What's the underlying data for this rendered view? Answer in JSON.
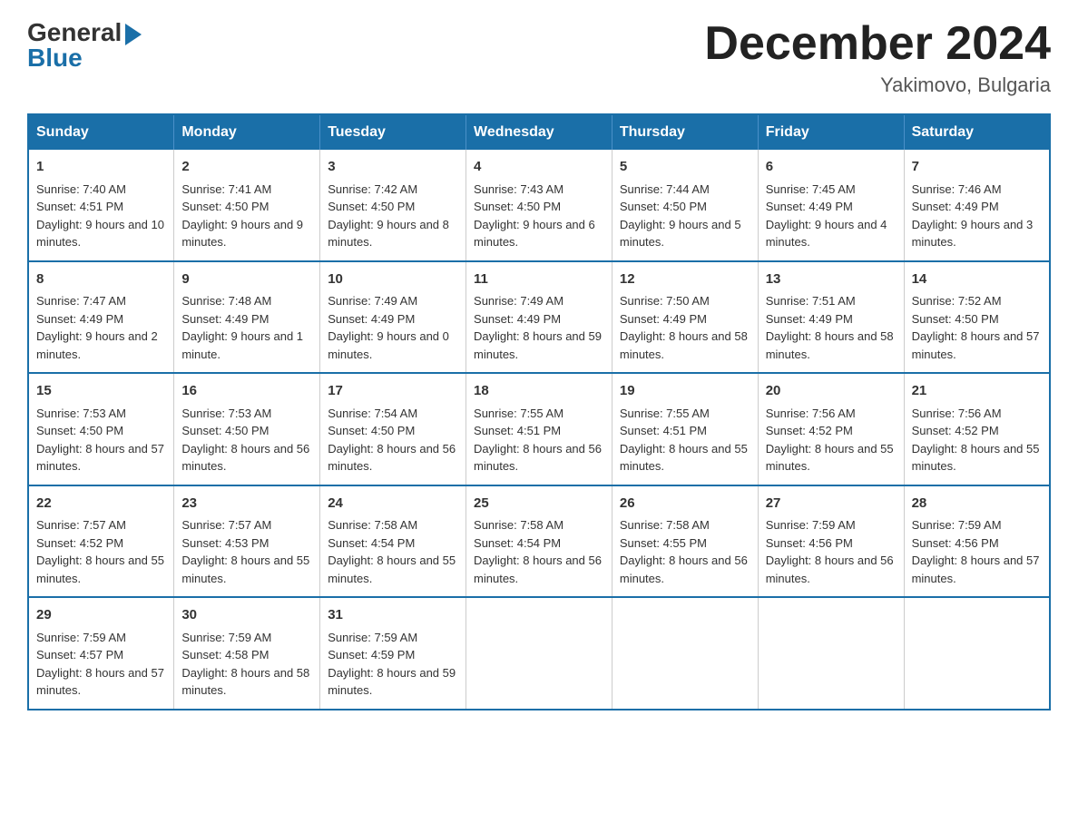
{
  "logo": {
    "general": "General",
    "blue": "Blue"
  },
  "title": "December 2024",
  "location": "Yakimovo, Bulgaria",
  "weekdays": [
    "Sunday",
    "Monday",
    "Tuesday",
    "Wednesday",
    "Thursday",
    "Friday",
    "Saturday"
  ],
  "weeks": [
    [
      {
        "day": "1",
        "sunrise": "7:40 AM",
        "sunset": "4:51 PM",
        "daylight": "9 hours and 10 minutes."
      },
      {
        "day": "2",
        "sunrise": "7:41 AM",
        "sunset": "4:50 PM",
        "daylight": "9 hours and 9 minutes."
      },
      {
        "day": "3",
        "sunrise": "7:42 AM",
        "sunset": "4:50 PM",
        "daylight": "9 hours and 8 minutes."
      },
      {
        "day": "4",
        "sunrise": "7:43 AM",
        "sunset": "4:50 PM",
        "daylight": "9 hours and 6 minutes."
      },
      {
        "day": "5",
        "sunrise": "7:44 AM",
        "sunset": "4:50 PM",
        "daylight": "9 hours and 5 minutes."
      },
      {
        "day": "6",
        "sunrise": "7:45 AM",
        "sunset": "4:49 PM",
        "daylight": "9 hours and 4 minutes."
      },
      {
        "day": "7",
        "sunrise": "7:46 AM",
        "sunset": "4:49 PM",
        "daylight": "9 hours and 3 minutes."
      }
    ],
    [
      {
        "day": "8",
        "sunrise": "7:47 AM",
        "sunset": "4:49 PM",
        "daylight": "9 hours and 2 minutes."
      },
      {
        "day": "9",
        "sunrise": "7:48 AM",
        "sunset": "4:49 PM",
        "daylight": "9 hours and 1 minute."
      },
      {
        "day": "10",
        "sunrise": "7:49 AM",
        "sunset": "4:49 PM",
        "daylight": "9 hours and 0 minutes."
      },
      {
        "day": "11",
        "sunrise": "7:49 AM",
        "sunset": "4:49 PM",
        "daylight": "8 hours and 59 minutes."
      },
      {
        "day": "12",
        "sunrise": "7:50 AM",
        "sunset": "4:49 PM",
        "daylight": "8 hours and 58 minutes."
      },
      {
        "day": "13",
        "sunrise": "7:51 AM",
        "sunset": "4:49 PM",
        "daylight": "8 hours and 58 minutes."
      },
      {
        "day": "14",
        "sunrise": "7:52 AM",
        "sunset": "4:50 PM",
        "daylight": "8 hours and 57 minutes."
      }
    ],
    [
      {
        "day": "15",
        "sunrise": "7:53 AM",
        "sunset": "4:50 PM",
        "daylight": "8 hours and 57 minutes."
      },
      {
        "day": "16",
        "sunrise": "7:53 AM",
        "sunset": "4:50 PM",
        "daylight": "8 hours and 56 minutes."
      },
      {
        "day": "17",
        "sunrise": "7:54 AM",
        "sunset": "4:50 PM",
        "daylight": "8 hours and 56 minutes."
      },
      {
        "day": "18",
        "sunrise": "7:55 AM",
        "sunset": "4:51 PM",
        "daylight": "8 hours and 56 minutes."
      },
      {
        "day": "19",
        "sunrise": "7:55 AM",
        "sunset": "4:51 PM",
        "daylight": "8 hours and 55 minutes."
      },
      {
        "day": "20",
        "sunrise": "7:56 AM",
        "sunset": "4:52 PM",
        "daylight": "8 hours and 55 minutes."
      },
      {
        "day": "21",
        "sunrise": "7:56 AM",
        "sunset": "4:52 PM",
        "daylight": "8 hours and 55 minutes."
      }
    ],
    [
      {
        "day": "22",
        "sunrise": "7:57 AM",
        "sunset": "4:52 PM",
        "daylight": "8 hours and 55 minutes."
      },
      {
        "day": "23",
        "sunrise": "7:57 AM",
        "sunset": "4:53 PM",
        "daylight": "8 hours and 55 minutes."
      },
      {
        "day": "24",
        "sunrise": "7:58 AM",
        "sunset": "4:54 PM",
        "daylight": "8 hours and 55 minutes."
      },
      {
        "day": "25",
        "sunrise": "7:58 AM",
        "sunset": "4:54 PM",
        "daylight": "8 hours and 56 minutes."
      },
      {
        "day": "26",
        "sunrise": "7:58 AM",
        "sunset": "4:55 PM",
        "daylight": "8 hours and 56 minutes."
      },
      {
        "day": "27",
        "sunrise": "7:59 AM",
        "sunset": "4:56 PM",
        "daylight": "8 hours and 56 minutes."
      },
      {
        "day": "28",
        "sunrise": "7:59 AM",
        "sunset": "4:56 PM",
        "daylight": "8 hours and 57 minutes."
      }
    ],
    [
      {
        "day": "29",
        "sunrise": "7:59 AM",
        "sunset": "4:57 PM",
        "daylight": "8 hours and 57 minutes."
      },
      {
        "day": "30",
        "sunrise": "7:59 AM",
        "sunset": "4:58 PM",
        "daylight": "8 hours and 58 minutes."
      },
      {
        "day": "31",
        "sunrise": "7:59 AM",
        "sunset": "4:59 PM",
        "daylight": "8 hours and 59 minutes."
      },
      null,
      null,
      null,
      null
    ]
  ],
  "labels": {
    "sunrise": "Sunrise:",
    "sunset": "Sunset:",
    "daylight": "Daylight:"
  }
}
